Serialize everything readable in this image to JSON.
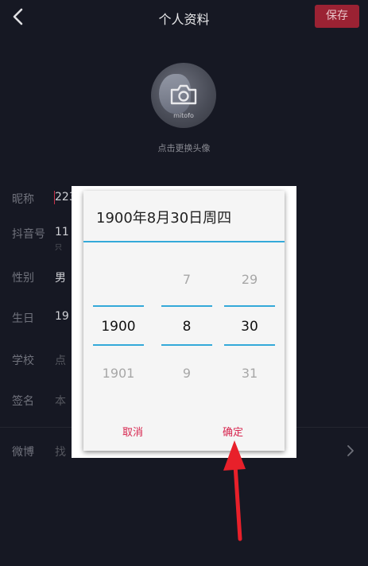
{
  "header": {
    "title": "个人资料",
    "save_label": "保存"
  },
  "avatar": {
    "watermark": "mitofo",
    "change_label": "点击更换头像"
  },
  "profile": {
    "nickname_label": "昵称",
    "nickname_value": "223",
    "douyin_id_label": "抖音号",
    "douyin_id_value": "11",
    "douyin_id_note": "只",
    "gender_label": "性别",
    "gender_value": "男",
    "birthday_label": "生日",
    "birthday_value": "19",
    "school_label": "学校",
    "school_value": "点",
    "signature_label": "签名",
    "signature_value": "本",
    "weibo_label": "微博",
    "weibo_value": "找"
  },
  "date_picker": {
    "title": "1900年8月30日周四",
    "year": {
      "prev": "",
      "selected": "1900",
      "next": "1901"
    },
    "month": {
      "prev": "7",
      "selected": "8",
      "next": "9"
    },
    "day": {
      "prev": "29",
      "selected": "30",
      "next": "31"
    },
    "cancel_label": "取消",
    "confirm_label": "确定",
    "accent_color": "#34a9d9",
    "button_color": "#d7264f"
  },
  "annotation": {
    "arrow_color": "#e8202a"
  },
  "icons": [
    "back-icon",
    "camera-icon",
    "chevron-right-icon",
    "annotation-arrow"
  ]
}
